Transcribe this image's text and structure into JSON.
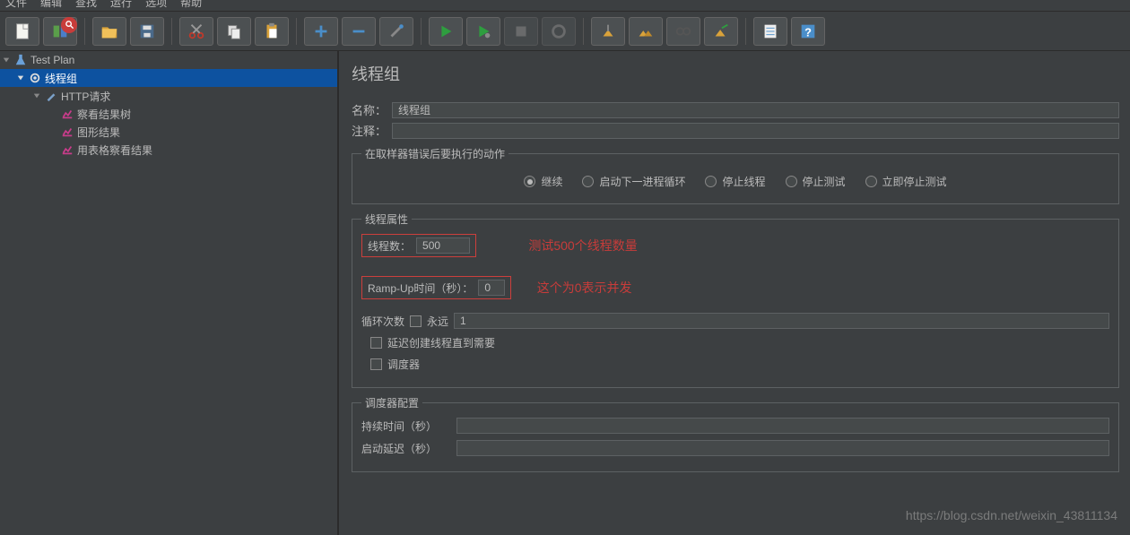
{
  "menu": {
    "file": "文件",
    "edit": "编辑",
    "find": "查找",
    "run": "运行",
    "options": "选项",
    "help": "帮助"
  },
  "tree": {
    "root": "Test Plan",
    "threadGroup": "线程组",
    "http": "HTTP请求",
    "resultTree": "察看结果树",
    "graphResult": "图形结果",
    "tableResult": "用表格察看结果"
  },
  "panel": {
    "title": "线程组",
    "nameLabel": "名称：",
    "nameValue": "线程组",
    "commentLabel": "注释：",
    "commentValue": "",
    "errorAction": {
      "legend": "在取样器错误后要执行的动作",
      "continue": "继续",
      "nextLoop": "启动下一进程循环",
      "stopThread": "停止线程",
      "stopTest": "停止测试",
      "stopNow": "立即停止测试"
    },
    "threadProps": {
      "legend": "线程属性",
      "threadsLabel": "线程数：",
      "threadsValue": "500",
      "rampLabel": "Ramp-Up时间（秒）：",
      "rampValue": "0",
      "loopLabel": "循环次数",
      "foreverLabel": "永远",
      "loopValue": "1",
      "delayLabel": "延迟创建线程直到需要",
      "schedulerLabel": "调度器"
    },
    "scheduler": {
      "legend": "调度器配置",
      "durationLabel": "持续时间（秒）",
      "durationValue": "",
      "startupDelayLabel": "启动延迟（秒）",
      "startupDelayValue": ""
    },
    "annot1": "测试500个线程数量",
    "annot2": "这个为0表示并发"
  },
  "watermark": "https://blog.csdn.net/weixin_43811134"
}
